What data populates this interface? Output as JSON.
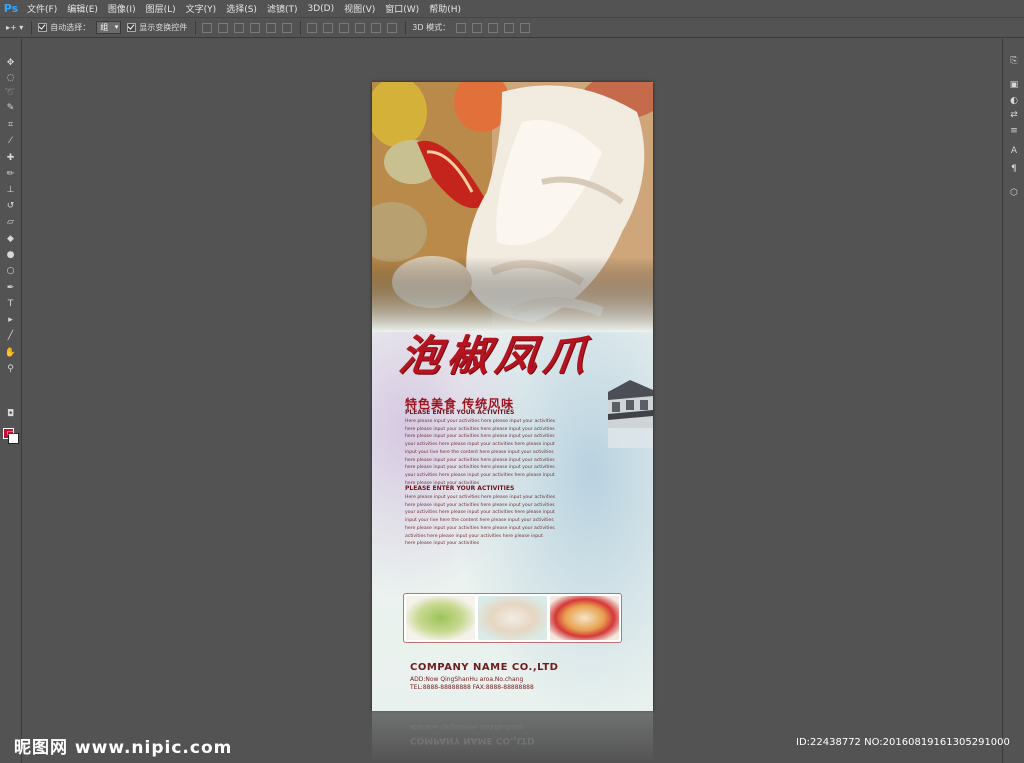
{
  "app": {
    "logo": "Ps"
  },
  "menu": [
    "文件(F)",
    "编辑(E)",
    "图像(I)",
    "图层(L)",
    "文字(Y)",
    "选择(S)",
    "滤镜(T)",
    "3D(D)",
    "视图(V)",
    "窗口(W)",
    "帮助(H)"
  ],
  "options": {
    "auto_select_label": "自动选择：",
    "auto_select_value": "组",
    "show_transform_label": "显示变换控件",
    "mode_3d_label": "3D 模式："
  },
  "poster": {
    "title": "泡椒凤爪",
    "subtitle": "特色美食 传统风味",
    "enter1": "PLEASE ENTER YOUR ACTIVITIES",
    "para1": [
      "Here please input your activities here please input your activities",
      "here please input your activities here please input your activities",
      "here please input your activities here please input your activities",
      "your activities here please input your activities here please input",
      "input your live here the content here please input your activities",
      "here please input your activities here please input your activities",
      "here please input your activities here please input your activities",
      "your activities here please input your activities here please input",
      "here please input your activities"
    ],
    "enter2": "PLEASE ENTER YOUR ACTIVITIES",
    "para2": [
      "Here please input your activities here please input your activities",
      "here please input your activities here please input your activities",
      "your activities here please input your activities here please input",
      "input your live here the content here please input your activities",
      "here please input your activities here please input your activities",
      "activities here please input your activities here please input",
      "here please input your activities"
    ],
    "company": "COMPANY NAME CO.,LTD",
    "address": "ADD:Now QingShanHu aroa.No.chang",
    "tel": "TEL:8888-88888888  FAX:8888-88888888"
  },
  "watermark": {
    "site": "昵图网 www.nipic.com",
    "id": "ID:22438772 NO:20160819161305291000"
  },
  "colors": {
    "accent": "#b3141f",
    "ui_bg": "#535353"
  }
}
